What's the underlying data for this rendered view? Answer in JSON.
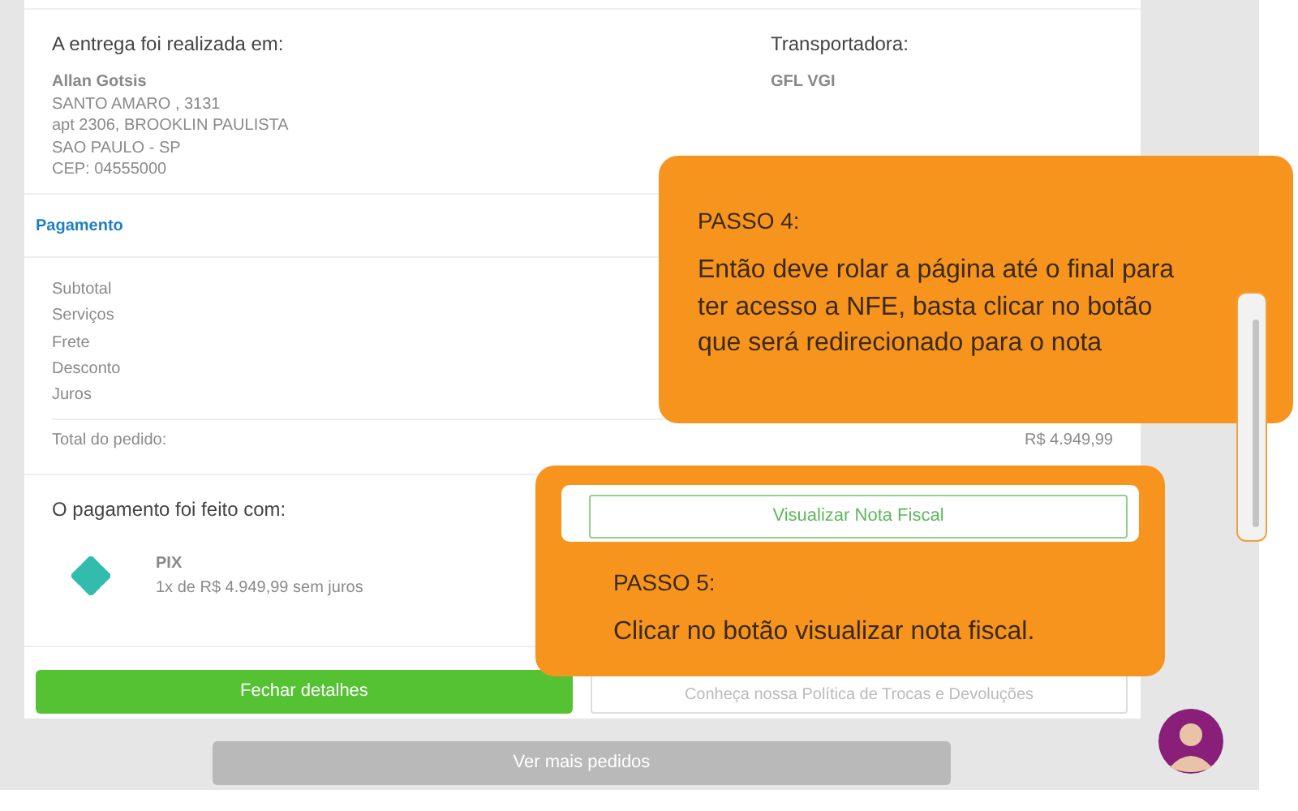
{
  "delivery": {
    "heading": "A entrega foi realizada em:",
    "name": "Allan Gotsis",
    "address_lines": [
      "SANTO AMARO , 3131",
      "apt 2306, BROOKLIN PAULISTA",
      "SAO PAULO - SP",
      "CEP: 04555000"
    ]
  },
  "carrier": {
    "heading": "Transportadora:",
    "value": "GFL VGI"
  },
  "payment": {
    "title": "Pagamento",
    "rows": [
      {
        "label": "Subtotal"
      },
      {
        "label": "Serviços"
      },
      {
        "label": "Frete"
      },
      {
        "label": "Desconto"
      },
      {
        "label": "Juros"
      }
    ],
    "total": {
      "label": "Total do pedido:",
      "value": "R$ 4.949,99"
    }
  },
  "payment_method": {
    "heading": "O pagamento foi feito com:",
    "name": "PIX",
    "detail": "1x de R$ 4.949,99 sem juros"
  },
  "buttons": {
    "invoice": "Visualizar Nota Fiscal",
    "close": "Fechar detalhes",
    "policy": "Conheça nossa Política de Trocas e Devoluções"
  },
  "more_button": "Ver mais pedidos",
  "steps": [
    {
      "title": "PASSO 4:",
      "text": "Então deve rolar a página até o final para ter acesso a NFE, basta clicar no botão que será redirecionado para o nota"
    },
    {
      "title": "PASSO 5:",
      "text": "Clicar no botão visualizar nota fiscal."
    }
  ]
}
